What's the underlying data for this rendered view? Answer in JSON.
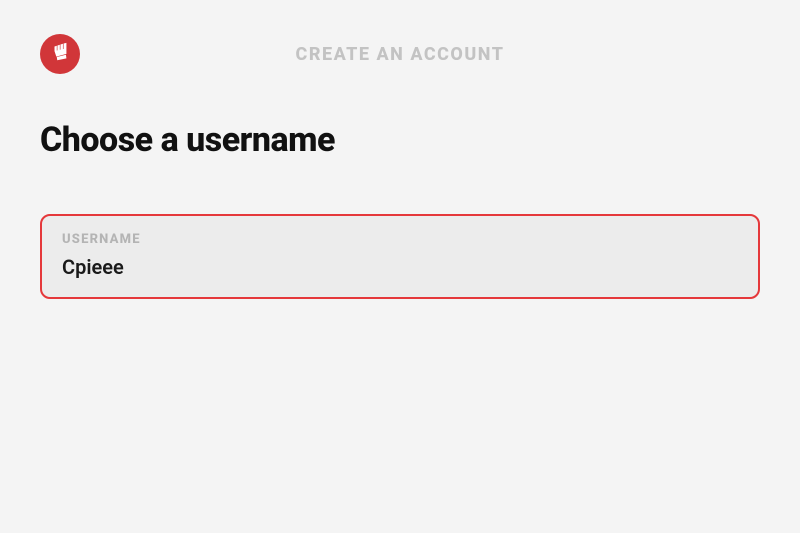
{
  "header": {
    "title": "CREATE AN ACCOUNT"
  },
  "page": {
    "title": "Choose a username"
  },
  "form": {
    "username_label": "USERNAME",
    "username_value": "Cpieee"
  }
}
